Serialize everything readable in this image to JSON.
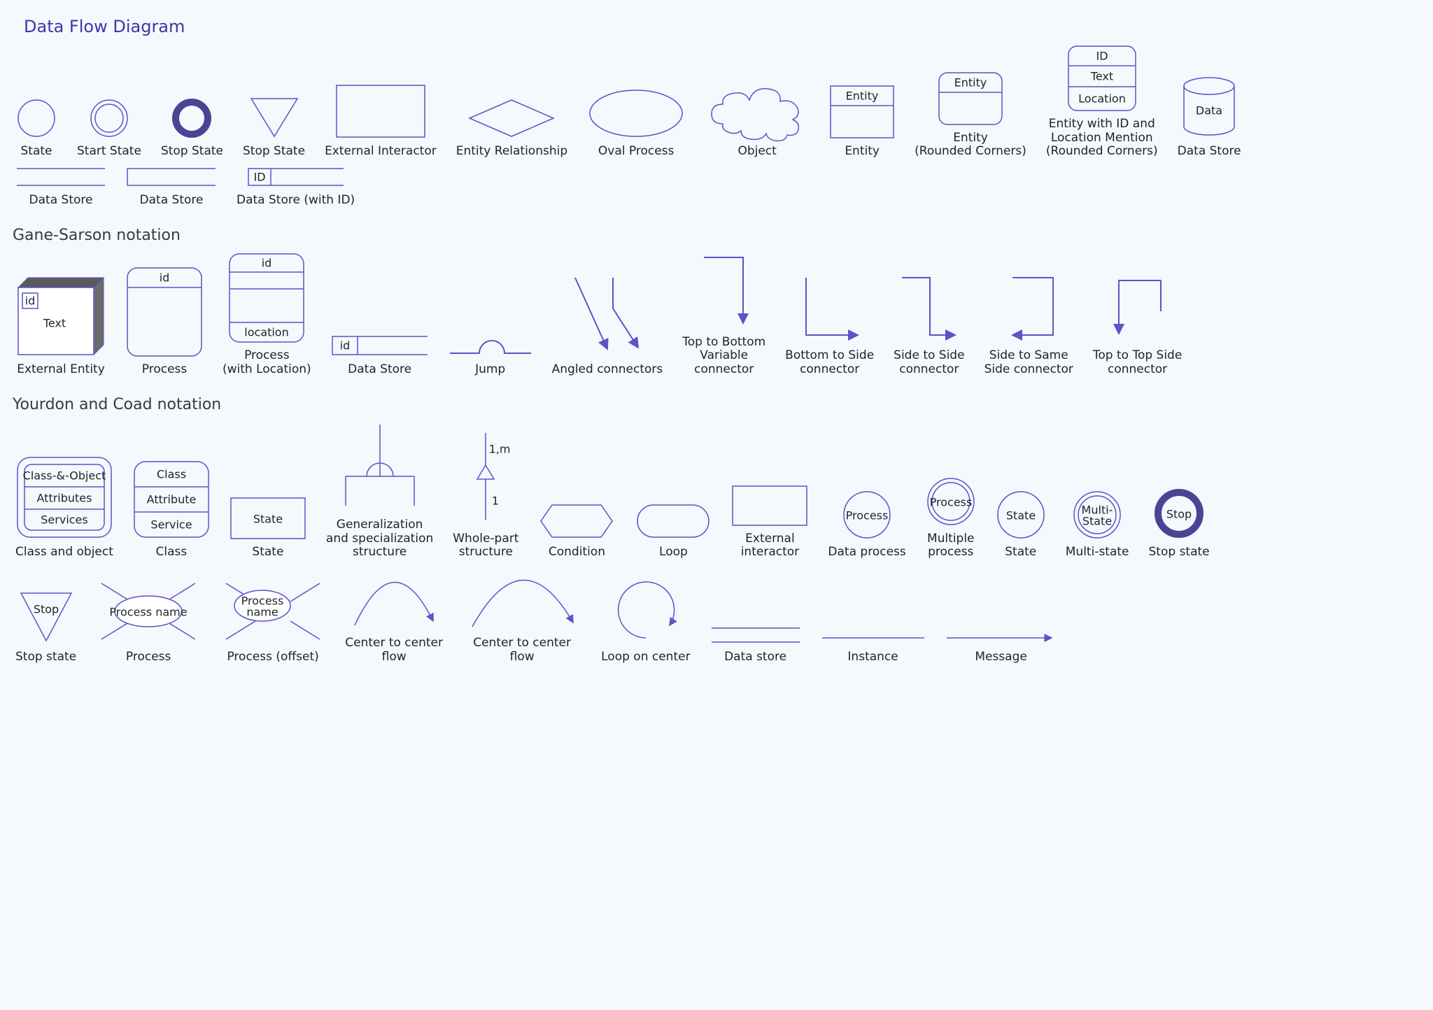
{
  "title": "Data Flow Diagram",
  "sections": {
    "dfd": {
      "heading": "Data Flow Diagram",
      "row1": {
        "state": "State",
        "start_state": "Start State",
        "stop_state": "Stop State",
        "stop_state2": "Stop State",
        "ext_interactor": "External Interactor",
        "entity_rel": "Entity Relationship",
        "oval_process": "Oval Process",
        "object": "Object",
        "entity": "Entity",
        "entity_label": "Entity",
        "entity_rc": "Entity\n(Rounded Corners)",
        "entity_id_loc": "Entity with ID and\nLocation Mention\n(Rounded Corners)",
        "id": "ID",
        "text": "Text",
        "location": "Location",
        "data_lbl": "Data",
        "data_store": "Data Store"
      },
      "row2": {
        "ds1": "Data Store",
        "ds2": "Data Store",
        "ds3": "Data Store (with ID)",
        "id": "ID"
      }
    },
    "gs": {
      "heading": "Gane-Sarson notation",
      "row1": {
        "ext_entity": "External Entity",
        "id": "id",
        "text": "Text",
        "process": "Process",
        "process_loc": "Process\n(with Location)",
        "location": "location",
        "data_store": "Data Store",
        "jump": "Jump",
        "angled": "Angled connectors",
        "ttb": "Top to Bottom\nVariable\nconnector",
        "bts": "Bottom to Side\nconnector",
        "sts": "Side to Side\nconnector",
        "stss": "Side to Same\nSide connector",
        "ttts": "Top to Top Side\nconnector"
      }
    },
    "yc": {
      "heading": "Yourdon and Coad notation",
      "row1": {
        "class_obj": "Class and object",
        "co_l1": "Class-&-Object",
        "co_l2": "Attributes",
        "co_l3": "Services",
        "class": "Class",
        "c_l1": "Class",
        "c_l2": "Attribute",
        "c_l3": "Service",
        "state": "State",
        "state_lbl": "State",
        "gs_struct": "Generalization\nand specialization\nstructure",
        "wp_struct": "Whole-part\nstructure",
        "wp_top": "1,m",
        "wp_bot": "1",
        "condition": "Condition",
        "loop": "Loop",
        "ext_int": "External\ninteractor",
        "dataproc": "Data process",
        "dp_lbl": "Process",
        "multproc": "Multiple\nprocess",
        "mp_lbl": "Process",
        "state2": "State",
        "st_lbl": "State",
        "multistate": "Multi-state",
        "ms_lbl": "Multi-\nState",
        "stopstate": "Stop state",
        "stop_lbl": "Stop"
      },
      "row2": {
        "stopstate2": "Stop state",
        "stop_lbl": "Stop",
        "process": "Process",
        "pname": "Process name",
        "process_off": "Process (offset)",
        "pname2": "Process\nname",
        "ctc1": "Center to center\nflow",
        "ctc2": "Center to center\nflow",
        "loopc": "Loop on center",
        "datastore": "Data store",
        "instance": "Instance",
        "message": "Message"
      }
    }
  }
}
